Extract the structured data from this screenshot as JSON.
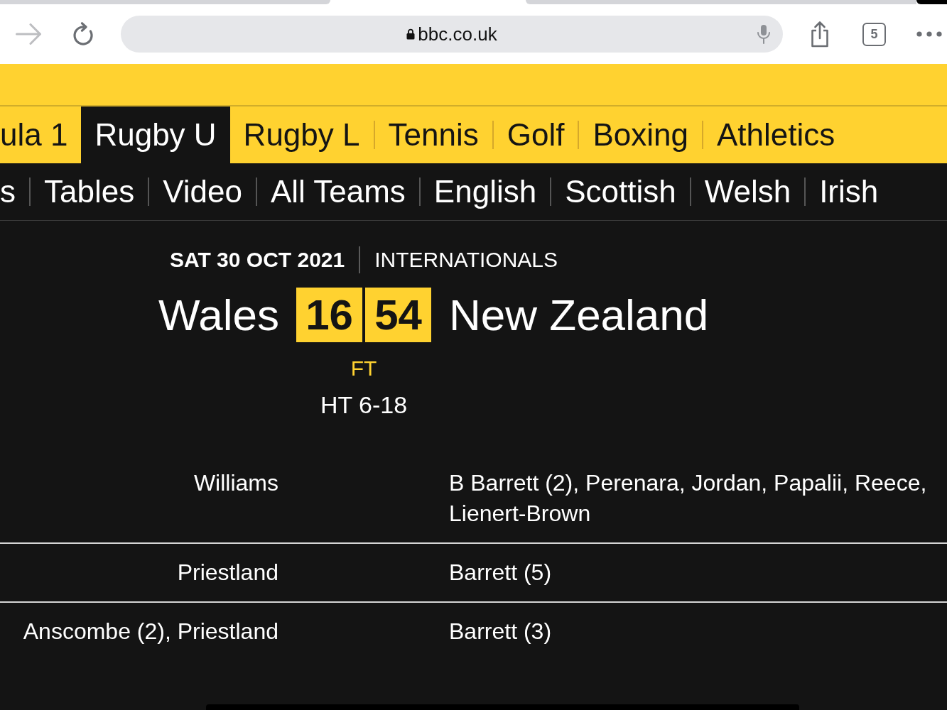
{
  "browser": {
    "forward_button": {
      "disabled": true
    },
    "address": "bbc.co.uk",
    "tab_count": "5"
  },
  "sport_nav": {
    "items": [
      {
        "label": "ula 1",
        "selected": false
      },
      {
        "label": "Rugby U",
        "selected": true
      },
      {
        "label": "Rugby L",
        "selected": false
      },
      {
        "label": "Tennis",
        "selected": false
      },
      {
        "label": "Golf",
        "selected": false
      },
      {
        "label": "Boxing",
        "selected": false
      },
      {
        "label": "Athletics",
        "selected": false
      }
    ]
  },
  "section_nav": {
    "items": [
      "s",
      "Tables",
      "Video",
      "All Teams",
      "English",
      "Scottish",
      "Welsh",
      "Irish"
    ]
  },
  "match": {
    "date": "SAT 30 OCT 2021",
    "competition": "INTERNATIONALS",
    "home_team": "Wales",
    "home_score": "16",
    "away_score": "54",
    "away_team": "New Zealand",
    "status": "FT",
    "half_time": "HT 6-18"
  },
  "score_rows": [
    {
      "home": "Williams",
      "away": "B Barrett (2), Perenara, Jordan, Papalii, Reece, Lienert-Brown"
    },
    {
      "home": "Priestland",
      "away": "Barrett (5)"
    },
    {
      "home": "Anscombe (2), Priestland",
      "away": "Barrett (3)"
    }
  ]
}
